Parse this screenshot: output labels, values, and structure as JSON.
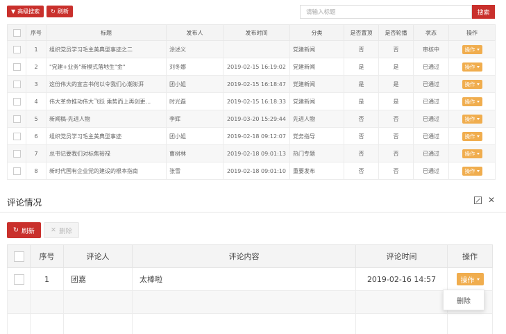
{
  "toolbar": {
    "advanced_search": "高级搜索",
    "refresh": "刷新"
  },
  "search": {
    "placeholder": "请输入标题",
    "button": "搜索"
  },
  "articles": {
    "columns": [
      "序号",
      "标题",
      "发布人",
      "发布时间",
      "分类",
      "是否置顶",
      "是否轮播",
      "状态",
      "操作"
    ],
    "op_label": "操作",
    "rows": [
      [
        "1",
        "组织党员学习毛主美典型事迹之二",
        "涂述义",
        "",
        "党建新闻",
        "否",
        "否",
        "审核中"
      ],
      [
        "2",
        "\"党建+业务\"新模式落地生\"金\"",
        "刘冬娜",
        "2019-02-15 16:19:02",
        "党建新闻",
        "是",
        "是",
        "已通过"
      ],
      [
        "3",
        "这份伟大的宣言书何以令我们心潮澎湃",
        "团小姐",
        "2019-02-15 16:18:47",
        "党建新闻",
        "是",
        "是",
        "已通过"
      ],
      [
        "4",
        "伟大革命推动伟大飞跃 乘势而上再创更...",
        "时光磊",
        "2019-02-15 16:18:33",
        "党建新闻",
        "是",
        "是",
        "已通过"
      ],
      [
        "5",
        "新闻稿-先进人物",
        "李辉",
        "2019-03-20 15:29:44",
        "先进人物",
        "否",
        "否",
        "已通过"
      ],
      [
        "6",
        "组织党员学习毛主美典型事迹",
        "团小姐",
        "2019-02-18 09:12:07",
        "党务指导",
        "否",
        "否",
        "已通过"
      ],
      [
        "7",
        "总书记要我们对标焦裕禄",
        "曹树林",
        "2019-02-18 09:01:13",
        "热门专题",
        "否",
        "否",
        "已通过"
      ],
      [
        "8",
        "新时代国有企业党的建设的根本指南",
        "张雪",
        "2019-02-18 09:01:10",
        "重要发布",
        "否",
        "否",
        "已通过"
      ]
    ]
  },
  "comments_panel": {
    "title": "评论情况",
    "refresh": "刷新",
    "delete": "删除",
    "columns": [
      "序号",
      "评论人",
      "评论内容",
      "评论时间",
      "操作"
    ],
    "op_label": "操作",
    "rows": [
      [
        "1",
        "团嘉",
        "太棒啦",
        "2019-02-16 14:57"
      ]
    ],
    "dropdown_item": "删除"
  },
  "colors": {
    "primary_red": "#c9302c",
    "op_orange": "#f0ad4e"
  }
}
